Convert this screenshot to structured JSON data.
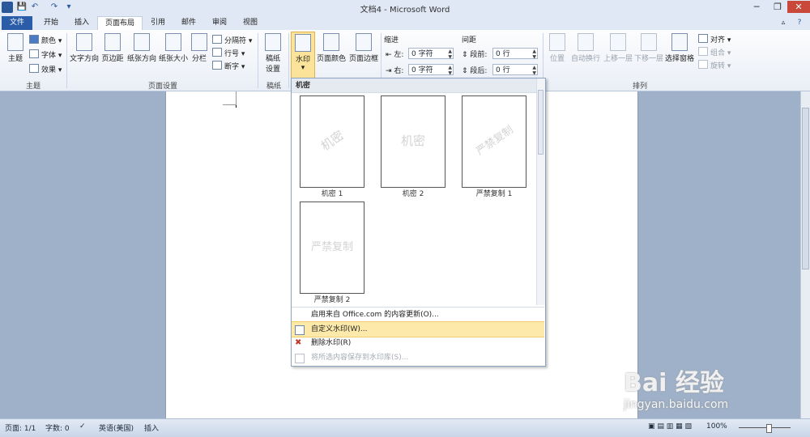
{
  "window": {
    "title": "文档4 - Microsoft Word",
    "app_icon": "W",
    "quick_access": [
      "save-icon",
      "undo-icon",
      "redo-icon",
      "customize-icon"
    ],
    "controls": {
      "minimize": "─",
      "restore": "❐",
      "close": "✕"
    }
  },
  "tabs": [
    "文件",
    "开始",
    "插入",
    "页面布局",
    "引用",
    "邮件",
    "审阅",
    "视图"
  ],
  "active_tab": "页面布局",
  "ribbon": {
    "theme": {
      "big": "主题",
      "colors": "颜色",
      "fonts": "字体",
      "effects": "效果",
      "label": "主题"
    },
    "page_setup": {
      "text_direction": "文字方向",
      "margins": "页边距",
      "orientation": "纸张方向",
      "size": "纸张大小",
      "columns": "分栏",
      "breaks": "分隔符",
      "line_numbers": "行号",
      "hyphenation": "断字",
      "label": "页面设置"
    },
    "draft": {
      "btn": "稿纸设置",
      "btn_line1": "稿纸",
      "btn_line2": "设置",
      "label": "稿纸"
    },
    "page_background": {
      "watermark": "水印",
      "page_color": "页面颜色",
      "page_borders": "页面边框"
    },
    "paragraph": {
      "indent_title": "缩进",
      "left_label": "左:",
      "left_value": "0 字符",
      "right_label": "右:",
      "right_value": "0 字符",
      "spacing_title": "间距",
      "before_label": "段前:",
      "before_value": "0 行",
      "after_label": "段后:",
      "after_value": "0 行",
      "label": "段落"
    },
    "arrange": {
      "position": "位置",
      "wrap": "自动换行",
      "bring_forward": "上移一层",
      "send_backward": "下移一层",
      "selection_pane": "选择窗格",
      "align": "对齐",
      "group": "组合",
      "rotate": "旋转",
      "label": "排列"
    }
  },
  "watermark_menu": {
    "section": "机密",
    "items": [
      {
        "label": "机密 1",
        "text": "机密"
      },
      {
        "label": "机密 2",
        "text": "机密"
      },
      {
        "label": "严禁复制 1",
        "text": "严禁复制"
      },
      {
        "label": "严禁复制 2",
        "text": "严禁复制"
      }
    ],
    "office_update": "启用来自 Office.com 的内容更新(O)...",
    "custom": "自定义水印(W)...",
    "remove": "删除水印(R)",
    "save_selection": "将所选内容保存到水印库(S)..."
  },
  "status": {
    "page": "页面: 1/1",
    "words": "字数: 0",
    "language": "英语(美国)",
    "mode": "插入",
    "zoom": "100%"
  },
  "overlay": {
    "brand": "Bai 经验",
    "url": "jingyan.baidu.com"
  }
}
